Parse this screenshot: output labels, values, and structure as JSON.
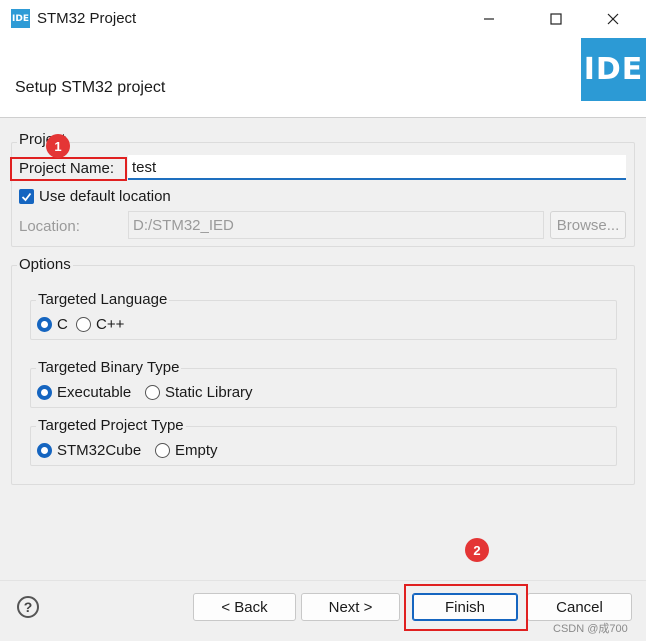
{
  "window": {
    "app_icon_text": "IDE",
    "title": "STM32 Project"
  },
  "header": {
    "title": "Setup STM32 project",
    "logo_text": "IDE"
  },
  "project_group": {
    "label": "Project",
    "name_label": "Project Name:",
    "name_value": "test",
    "use_default_label": "Use default location",
    "use_default_checked": true,
    "location_label": "Location:",
    "location_value": "D:/STM32_IED",
    "browse_label": "Browse..."
  },
  "options": {
    "label": "Options",
    "language": {
      "label": "Targeted Language",
      "opt1": "C",
      "opt2": "C++",
      "selected": "C"
    },
    "binary": {
      "label": "Targeted Binary Type",
      "opt1": "Executable",
      "opt2": "Static Library",
      "selected": "Executable"
    },
    "project_type": {
      "label": "Targeted Project Type",
      "opt1": "STM32Cube",
      "opt2": "Empty",
      "selected": "STM32Cube"
    }
  },
  "annotations": {
    "badge1": "1",
    "badge2": "2"
  },
  "buttons": {
    "help": "?",
    "back": "< Back",
    "next": "Next >",
    "finish": "Finish",
    "cancel": "Cancel"
  },
  "watermark": "CSDN @成700",
  "colors": {
    "accent": "#1565c0",
    "logo": "#2c9ad5",
    "annotation": "#e02020"
  }
}
